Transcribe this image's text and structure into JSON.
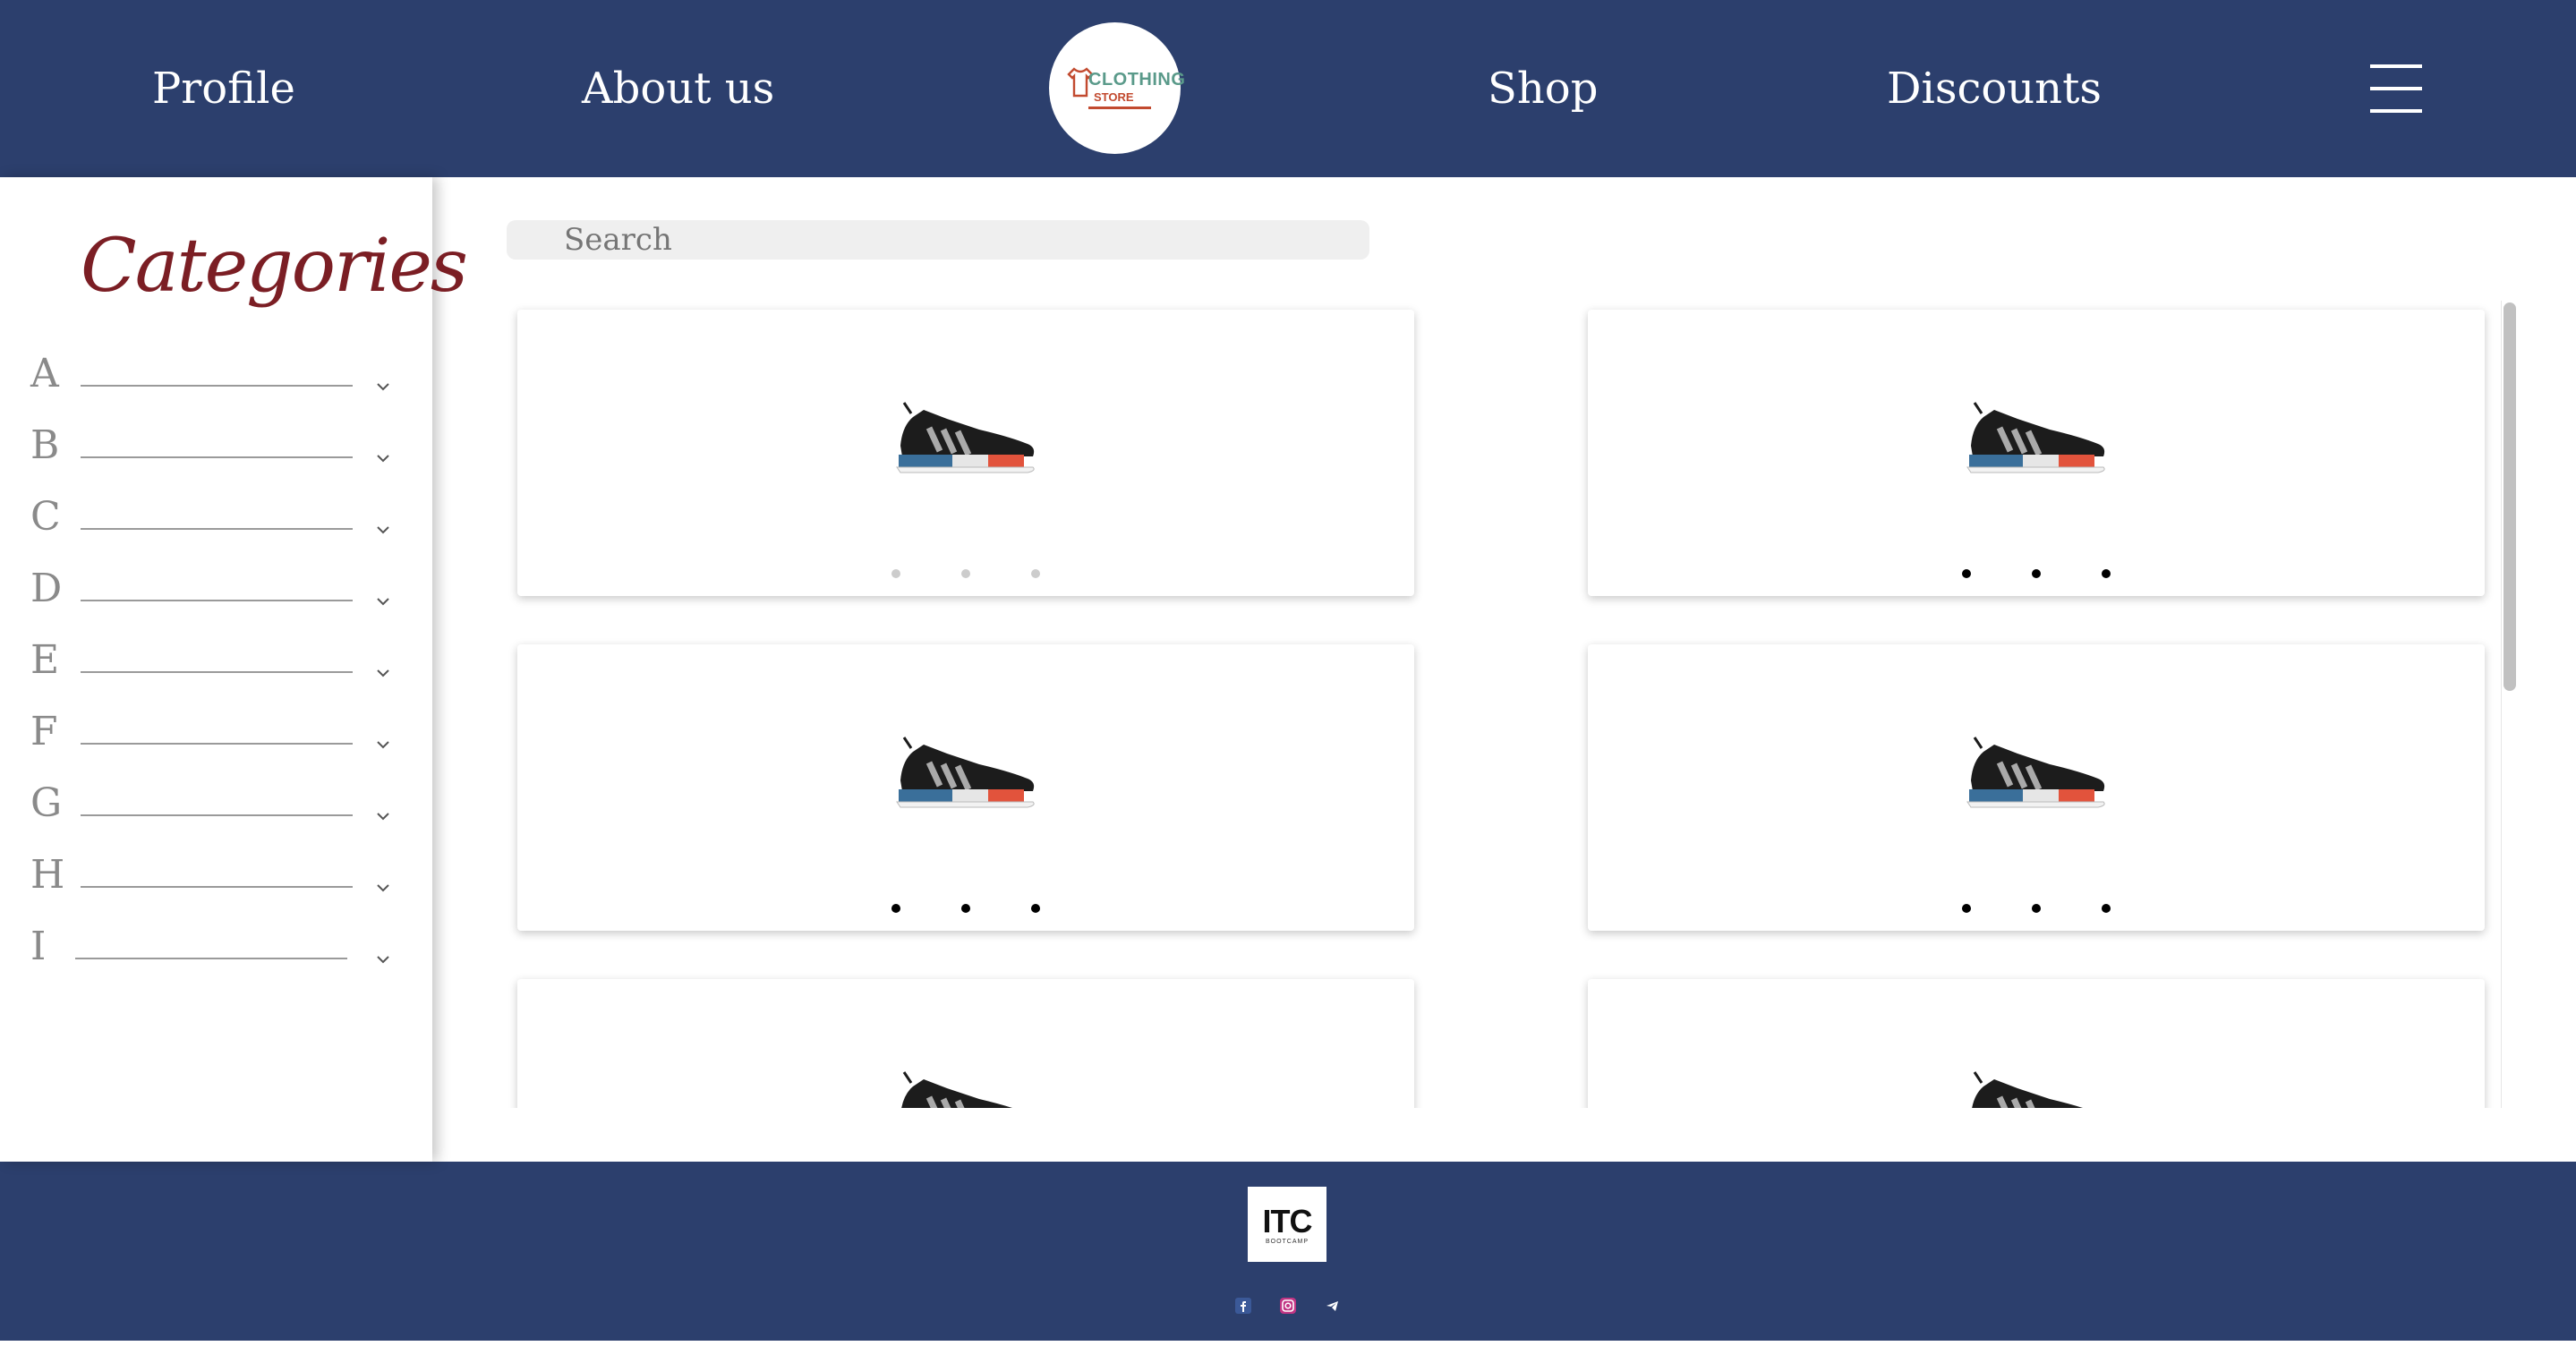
{
  "header": {
    "nav": [
      {
        "label": "Profile"
      },
      {
        "label": "About us"
      },
      {
        "label": "Shop"
      },
      {
        "label": "Discounts"
      }
    ],
    "logo": {
      "line1": "CLOTHING",
      "line2": "STORE"
    },
    "menu_icon": "hamburger-icon"
  },
  "sidebar": {
    "title": "Categories",
    "categories": [
      {
        "label": "A"
      },
      {
        "label": "B"
      },
      {
        "label": "C"
      },
      {
        "label": "D"
      },
      {
        "label": "E"
      },
      {
        "label": "F"
      },
      {
        "label": "G"
      },
      {
        "label": "H"
      },
      {
        "label": "I"
      }
    ],
    "chevron_icon": "chevron-down-icon"
  },
  "search": {
    "placeholder": "Search",
    "value": ""
  },
  "products": {
    "image_icon": "sneaker-image",
    "count_visible": 6,
    "carousel_dots": 3
  },
  "footer": {
    "logo": {
      "title": "ITC",
      "subtitle": "BOOTCAMP"
    },
    "social": [
      "facebook-icon",
      "instagram-icon",
      "telegram-icon"
    ]
  },
  "colors": {
    "brand_navy": "#2c3f6d",
    "category_title": "#7b1e24",
    "logo_teal": "#5a9a8a",
    "logo_rust": "#c24a2f"
  }
}
